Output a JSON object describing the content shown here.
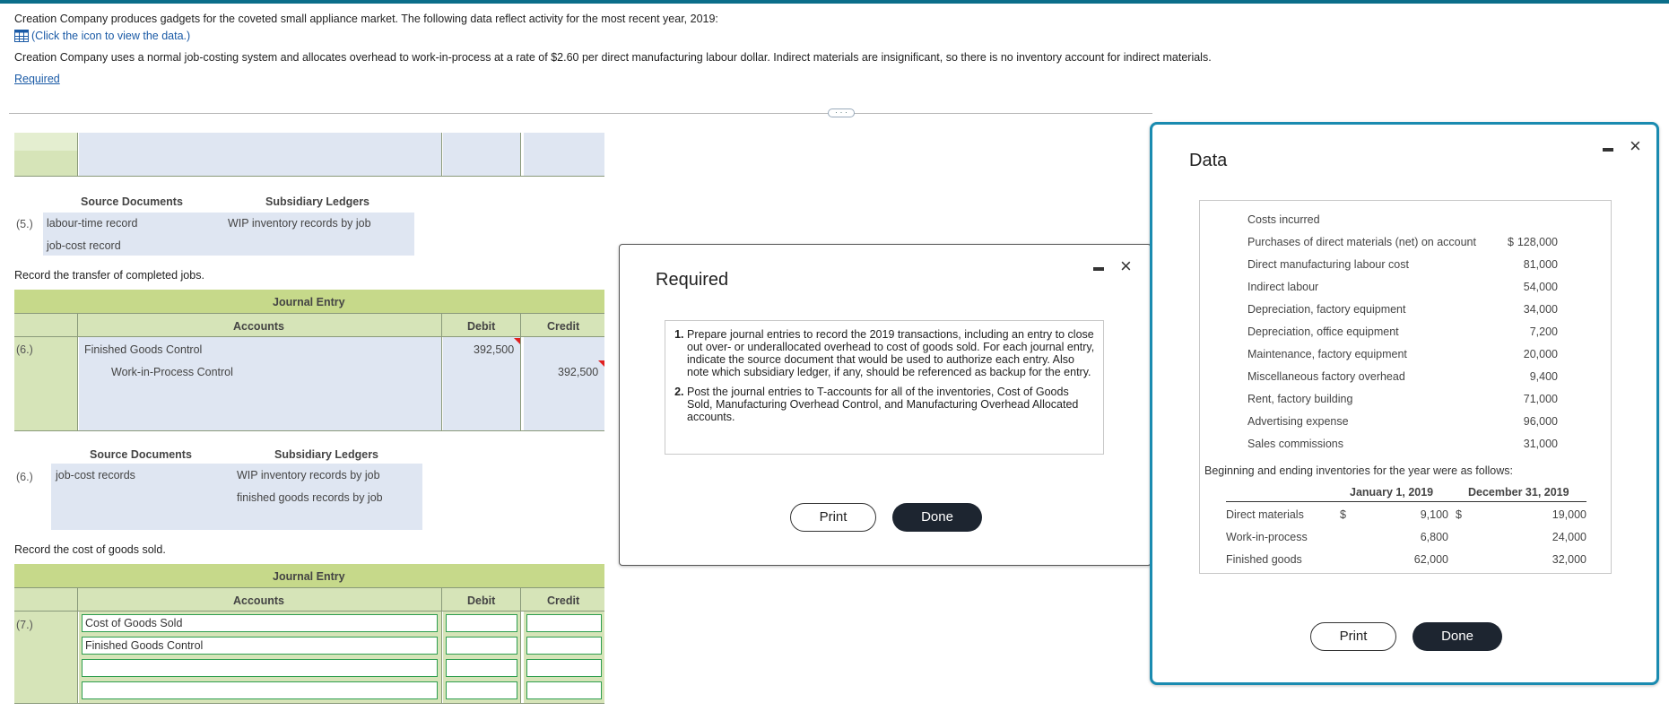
{
  "intro": {
    "line1": "Creation Company produces gadgets for the coveted small appliance market. The following data reflect activity for the most recent year, 2019:",
    "icon_link": "(Click the icon to view the data.)",
    "line2": "Creation Company uses a normal job-costing system and allocates overhead to work-in-process at a rate of $2.60 per direct manufacturing labour dollar. Indirect materials are insignificant, so there is no inventory account for indirect materials.",
    "required_link": "Required"
  },
  "section5": {
    "label": "(5.)",
    "src_header": "Source Documents",
    "sub_header": "Subsidiary Ledgers",
    "src_items": [
      "labour-time record",
      "job-cost record"
    ],
    "sub_items": [
      "WIP inventory records by job"
    ]
  },
  "section6": {
    "instruction": "Record the transfer of completed jobs.",
    "title": "Journal Entry",
    "col_accounts": "Accounts",
    "col_debit": "Debit",
    "col_credit": "Credit",
    "label": "(6.)",
    "row1_account": "Finished Goods Control",
    "row1_debit": "392,500",
    "row2_account": "Work-in-Process Control",
    "row2_credit": "392,500",
    "src_label": "(6.)",
    "src_header": "Source Documents",
    "sub_header": "Subsidiary Ledgers",
    "src_items": [
      "job-cost records"
    ],
    "sub_items": [
      "WIP inventory records by job",
      "finished goods records by job"
    ]
  },
  "section7": {
    "instruction": "Record the cost of goods sold.",
    "title": "Journal Entry",
    "col_accounts": "Accounts",
    "col_debit": "Debit",
    "col_credit": "Credit",
    "label": "(7.)",
    "row1_account": "Cost of Goods Sold",
    "row2_account": "Finished Goods Control"
  },
  "required_modal": {
    "title": "Required",
    "items": [
      "Prepare journal entries to record the 2019 transactions, including an entry to close out over- or underallocated overhead to cost of goods sold. For each journal entry, indicate the source document that would be used to authorize each entry. Also note which subsidiary ledger, if any, should be referenced as backup for the entry.",
      "Post the journal entries to T-accounts for all of the inventories, Cost of Goods Sold, Manufacturing Overhead Control, and Manufacturing Overhead Allocated accounts."
    ],
    "print_label": "Print",
    "done_label": "Done",
    "close_symbol": "×"
  },
  "data_modal": {
    "title": "Data",
    "costs_header": "Costs incurred",
    "costs": [
      {
        "label": "Purchases of direct materials (net) on account",
        "dollar": "$",
        "value": "128,000"
      },
      {
        "label": "Direct manufacturing labour cost",
        "dollar": "",
        "value": "81,000"
      },
      {
        "label": "Indirect labour",
        "dollar": "",
        "value": "54,000"
      },
      {
        "label": "Depreciation, factory equipment",
        "dollar": "",
        "value": "34,000"
      },
      {
        "label": "Depreciation, office equipment",
        "dollar": "",
        "value": "7,200"
      },
      {
        "label": "Maintenance, factory equipment",
        "dollar": "",
        "value": "20,000"
      },
      {
        "label": "Miscellaneous factory overhead",
        "dollar": "",
        "value": "9,400"
      },
      {
        "label": "Rent, factory building",
        "dollar": "",
        "value": "71,000"
      },
      {
        "label": "Advertising expense",
        "dollar": "",
        "value": "96,000"
      },
      {
        "label": "Sales commissions",
        "dollar": "",
        "value": "31,000"
      }
    ],
    "inventory_intro": "Beginning and ending inventories for the year were as follows:",
    "inv_col1": "January 1, 2019",
    "inv_col2": "December 31, 2019",
    "inventories": [
      {
        "label": "Direct materials",
        "d1": "$",
        "jan": "9,100",
        "d2": "$",
        "dec": "19,000"
      },
      {
        "label": "Work-in-process",
        "d1": "",
        "jan": "6,800",
        "d2": "",
        "dec": "24,000"
      },
      {
        "label": "Finished goods",
        "d1": "",
        "jan": "62,000",
        "d2": "",
        "dec": "32,000"
      }
    ],
    "print_label": "Print",
    "done_label": "Done",
    "close_symbol": "×"
  }
}
